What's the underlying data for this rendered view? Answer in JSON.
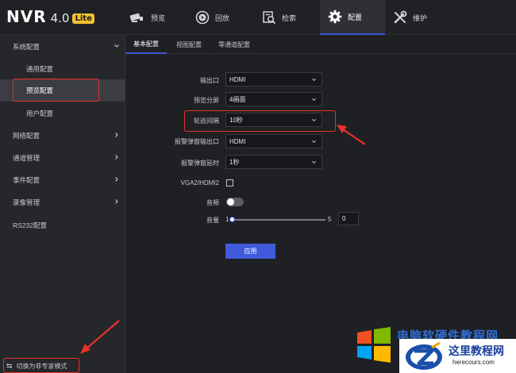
{
  "brand": {
    "name": "NVR",
    "version": "4.0",
    "badge": "Lite"
  },
  "nav": {
    "tabs": [
      {
        "label": "预览",
        "icon": "camera-icon"
      },
      {
        "label": "回放",
        "icon": "playback-icon"
      },
      {
        "label": "检索",
        "icon": "search-icon"
      },
      {
        "label": "配置",
        "icon": "gear-icon",
        "active": true
      },
      {
        "label": "维护",
        "icon": "tools-icon"
      }
    ]
  },
  "sidebar": {
    "items": [
      {
        "label": "系统配置",
        "expanded": true
      },
      {
        "label": "通用配置"
      },
      {
        "label": "预览配置",
        "active": true
      },
      {
        "label": "用户配置"
      },
      {
        "label": "网络配置"
      },
      {
        "label": "通道管理"
      },
      {
        "label": "事件配置"
      },
      {
        "label": "录像管理"
      },
      {
        "label": "RS232配置"
      }
    ],
    "mode_switch": "切换为非专家模式"
  },
  "subtabs": [
    "基本配置",
    "视图配置",
    "零通道配置"
  ],
  "form": {
    "output": {
      "label": "输出口",
      "value": "HDMI"
    },
    "split": {
      "label": "预览分屏",
      "value": "4画面"
    },
    "interval": {
      "label": "轮巡间隔",
      "value": "10秒"
    },
    "alarm_output": {
      "label": "报警弹窗输出口",
      "value": "HDMI"
    },
    "alarm_delay": {
      "label": "报警弹窗延时",
      "value": "1秒"
    },
    "vga": {
      "label": "VGA2/HDMI2",
      "checked": false
    },
    "audio": {
      "label": "音频",
      "enabled": false
    },
    "volume": {
      "label": "音量",
      "min": "1",
      "max": "5",
      "value": "0"
    },
    "apply": "应用"
  },
  "watermark": {
    "line1": "电脑软硬件教程网",
    "title": "这里教程网",
    "url": "herecours.com"
  },
  "colors": {
    "accent": "#3f5bdb",
    "annotation": "#e8322a"
  }
}
